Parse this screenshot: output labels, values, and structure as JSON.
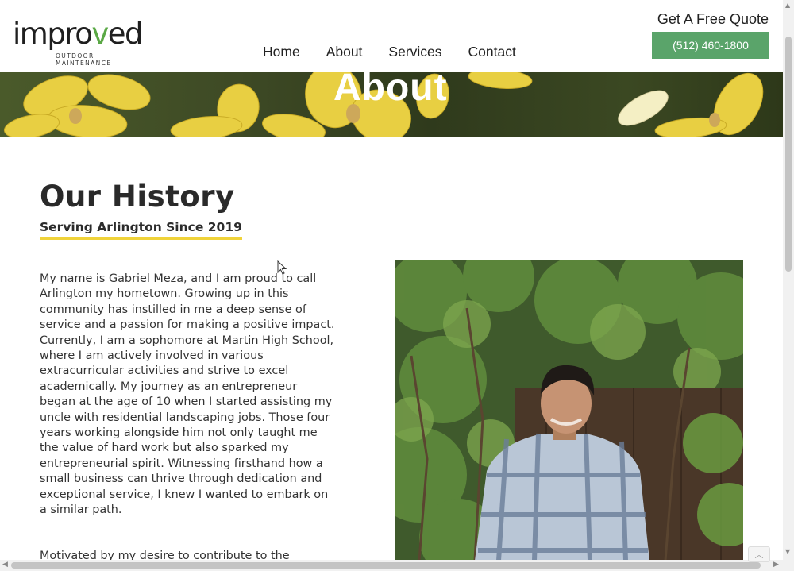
{
  "brand": {
    "logo_part1": "impro",
    "logo_accent": "v",
    "logo_part2": "ed",
    "tagline": "OUTDOOR MAINTENANCE",
    "accent_color": "#5aa845"
  },
  "nav": {
    "items": [
      {
        "label": "Home"
      },
      {
        "label": "About"
      },
      {
        "label": "Services"
      },
      {
        "label": "Contact"
      }
    ]
  },
  "quote": {
    "title": "Get A Free Quote",
    "phone": "(512) 460-1800",
    "button_color": "#5aa46a"
  },
  "banner": {
    "title": "About"
  },
  "history": {
    "heading": "Our History",
    "subheading": "Serving Arlington Since 2019",
    "underline_color": "#f0d33a",
    "paragraph1": "My name is Gabriel Meza, and I am proud to call Arlington my hometown. Growing up in this community has instilled in me a deep sense of service and a passion for making a positive impact. Currently, I am a sophomore at Martin High School, where I am actively involved in various extracurricular activities and strive to excel academically. My journey as an entrepreneur began at the age of 10 when I started assisting my uncle with residential landscaping jobs. Those four years working alongside him not only taught me the value of hard work but also sparked my entrepreneurial spirit. Witnessing firsthand how a small business can thrive through dedication and exceptional service, I knew I wanted to embark on a similar path.",
    "paragraph2": "Motivated by my desire to contribute to the"
  },
  "icons": {
    "scroll_up": "chevron-up-icon",
    "scroll_down": "chevron-down-icon",
    "scroll_left": "chevron-left-icon",
    "scroll_right": "chevron-right-icon",
    "back_to_top": "chevron-up-icon",
    "cursor": "mouse-pointer-icon"
  }
}
